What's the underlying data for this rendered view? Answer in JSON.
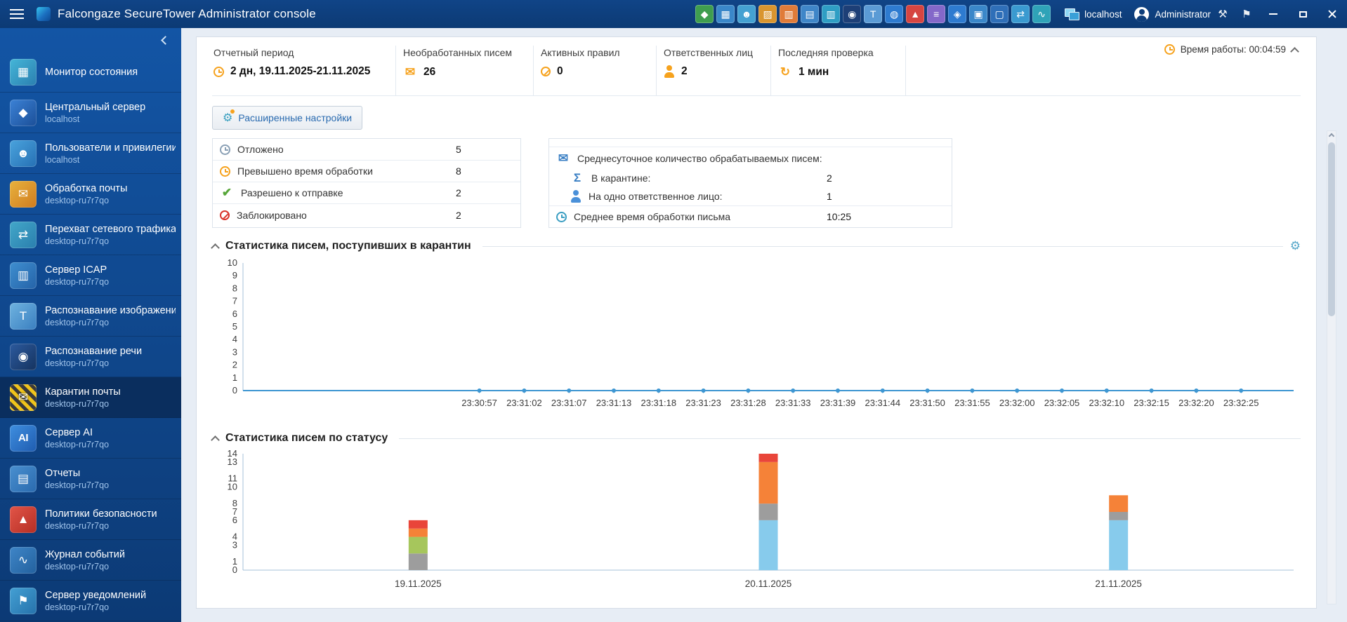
{
  "titlebar": {
    "title": "Falcongaze SecureTower Administrator console",
    "host": "localhost",
    "user": "Administrator",
    "toolbar_icons": [
      {
        "name": "shield",
        "glyph": "◆",
        "bg": "#3f9e4f"
      },
      {
        "name": "status-monitor",
        "glyph": "▦",
        "bg": "#3a87c9"
      },
      {
        "name": "users",
        "glyph": "☻",
        "bg": "#44a1d2"
      },
      {
        "name": "mail-archive",
        "glyph": "▨",
        "bg": "#d9952f"
      },
      {
        "name": "mail-processing",
        "glyph": "▥",
        "bg": "#e07b39"
      },
      {
        "name": "documents",
        "glyph": "▤",
        "bg": "#3f86c8"
      },
      {
        "name": "icap",
        "glyph": "▥",
        "bg": "#2f9ec4"
      },
      {
        "name": "speech-recognition",
        "glyph": "◉",
        "bg": "#1d3f77"
      },
      {
        "name": "image-recognition",
        "glyph": "T",
        "bg": "#5b9bd5"
      },
      {
        "name": "web",
        "glyph": "◍",
        "bg": "#2e7bd0"
      },
      {
        "name": "security-policies",
        "glyph": "▲",
        "bg": "#d64541"
      },
      {
        "name": "statistics",
        "glyph": "≡",
        "bg": "#8468c9"
      },
      {
        "name": "ai-server",
        "glyph": "◈",
        "bg": "#2e7bd0"
      },
      {
        "name": "endpoint",
        "glyph": "▣",
        "bg": "#3a87c9"
      },
      {
        "name": "console",
        "glyph": "▢",
        "bg": "#2f6fb8"
      },
      {
        "name": "network",
        "glyph": "⇄",
        "bg": "#3a9ad0"
      },
      {
        "name": "data-flow",
        "glyph": "∿",
        "bg": "#2fa3b8"
      }
    ]
  },
  "icon_glyphs": {
    "mail": "✉",
    "check": "✔",
    "sigma": "Σ",
    "refresh": "↻",
    "gear": "⚙",
    "tools": "⚒",
    "announcement": "⚑"
  },
  "sidebar": {
    "items": [
      {
        "id": "status-monitor",
        "label": "Монитор состояния",
        "sub": "",
        "glyph": "▦",
        "bg": "linear-gradient(135deg,#45b6d8,#2b7fb0)"
      },
      {
        "id": "central-server",
        "label": "Центральный сервер",
        "sub": "localhost",
        "glyph": "◆",
        "bg": "linear-gradient(135deg,#3c82d6,#1b4f98)"
      },
      {
        "id": "users-privileges",
        "label": "Пользователи и привилегии",
        "sub": "localhost",
        "glyph": "☻",
        "bg": "linear-gradient(135deg,#4aa3dd,#2670b4)"
      },
      {
        "id": "mail-processing",
        "label": "Обработка почты",
        "sub": "desktop-ru7r7qo",
        "glyph": "✉",
        "bg": "linear-gradient(135deg,#e8b23d,#d07c1f)"
      },
      {
        "id": "traffic-interception",
        "label": "Перехват сетевого трафика",
        "sub": "desktop-ru7r7qo",
        "glyph": "⇄",
        "bg": "linear-gradient(135deg,#43a7c9,#2a7fae)"
      },
      {
        "id": "icap-server",
        "label": "Сервер ICAP",
        "sub": "desktop-ru7r7qo",
        "glyph": "▥",
        "bg": "linear-gradient(135deg,#3f8fd0,#2563a8)"
      },
      {
        "id": "image-recognition",
        "label": "Распознавание изображений",
        "sub": "desktop-ru7r7qo",
        "glyph": "T",
        "bg": "linear-gradient(135deg,#6fb3e0,#3a7fc0)"
      },
      {
        "id": "speech-recognition",
        "label": "Распознавание речи",
        "sub": "desktop-ru7r7qo",
        "glyph": "◉",
        "bg": "linear-gradient(135deg,#2c5a9e,#15335f)"
      },
      {
        "id": "mail-quarantine",
        "label": "Карантин почты",
        "sub": "desktop-ru7r7qo",
        "glyph": "✉",
        "stripes": true,
        "selected": true
      },
      {
        "id": "ai-server",
        "label": "Сервер AI",
        "sub": "desktop-ru7r7qo",
        "glyph": "AI",
        "bg": "linear-gradient(135deg,#3f8fe0,#1f5cb0)"
      },
      {
        "id": "reports",
        "label": "Отчеты",
        "sub": "desktop-ru7r7qo",
        "glyph": "▤",
        "bg": "linear-gradient(135deg,#4a90d0,#2a6aae)"
      },
      {
        "id": "security-policies",
        "label": "Политики безопасности",
        "sub": "desktop-ru7r7qo",
        "glyph": "▲",
        "bg": "linear-gradient(135deg,#e25548,#b52e24)"
      },
      {
        "id": "event-log",
        "label": "Журнал событий",
        "sub": "desktop-ru7r7qo",
        "glyph": "∿",
        "bg": "linear-gradient(135deg,#3f86c8,#23619e)"
      },
      {
        "id": "notification-server",
        "label": "Сервер уведомлений",
        "sub": "desktop-ru7r7qo",
        "glyph": "⚑",
        "bg": "linear-gradient(135deg,#44a0d4,#2672ab)"
      }
    ]
  },
  "overview": {
    "uptime": "Время работы: 00:04:59",
    "advanced_button": "Расширенные настройки",
    "cards": [
      {
        "id": "report-period",
        "label": "Отчетный период",
        "value": "2 дн, 19.11.2025-21.11.2025",
        "icon": "clock",
        "icon_color": "#f6a21d"
      },
      {
        "id": "unprocessed-mail",
        "label": "Необработанных писем",
        "value": "26",
        "icon": "mail",
        "icon_color": "#f6a21d"
      },
      {
        "id": "active-rules",
        "label": "Активных правил",
        "value": "0",
        "icon": "ban",
        "icon_color": "#f6a21d"
      },
      {
        "id": "responsible-persons",
        "label": "Ответственных лиц",
        "value": "2",
        "icon": "person",
        "icon_color": "#f6a21d"
      },
      {
        "id": "last-check",
        "label": "Последняя проверка",
        "value": "1 мин",
        "icon": "refresh",
        "icon_color": "#f6a21d"
      }
    ]
  },
  "quarantine_stats": {
    "left_rows": [
      {
        "label": "Отложено",
        "value": "5",
        "icon": "clock",
        "icon_color": "#8aa0b5"
      },
      {
        "label": "Превышено время обработки",
        "value": "8",
        "icon": "clock",
        "icon_color": "#f6a21d"
      },
      {
        "label": "Разрешено к отправке",
        "value": "2",
        "icon": "check",
        "icon_color": "#57a639"
      },
      {
        "label": "Заблокировано",
        "value": "2",
        "icon": "ban",
        "icon_color": "#d9342b"
      }
    ],
    "right": {
      "header": {
        "label": "Среднесуточное количество обрабатываемых писем:",
        "icon": "mail",
        "icon_color": "#3a7fc4"
      },
      "rows": [
        {
          "label": "В карантине:",
          "value": "2",
          "icon": "sigma",
          "icon_color": "#3a7fc4"
        },
        {
          "label": "На одно ответственное лицо:",
          "value": "1",
          "icon": "person",
          "icon_color": "#4a90d9"
        }
      ],
      "footer": {
        "label": "Среднее время обработки письма",
        "value": "10:25",
        "icon": "clock",
        "icon_color": "#3a9ec2"
      }
    }
  },
  "chart_data": [
    {
      "type": "line",
      "title": "Статистика писем, поступивших в карантин",
      "x": [
        "23:30:57",
        "23:31:02",
        "23:31:07",
        "23:31:13",
        "23:31:18",
        "23:31:23",
        "23:31:28",
        "23:31:33",
        "23:31:39",
        "23:31:44",
        "23:31:50",
        "23:31:55",
        "23:32:00",
        "23:32:05",
        "23:32:10",
        "23:32:15",
        "23:32:20",
        "23:32:25"
      ],
      "values": [
        0,
        0,
        0,
        0,
        0,
        0,
        0,
        0,
        0,
        0,
        0,
        0,
        0,
        0,
        0,
        0,
        0,
        0
      ],
      "xlabel": "",
      "ylabel": "",
      "ylim": [
        0,
        10
      ],
      "yticks": [
        0,
        1,
        2,
        3,
        4,
        5,
        6,
        7,
        8,
        9,
        10
      ],
      "grid": false,
      "legend": "none",
      "line_color": "#3d96d2",
      "x_start_frac": 0.225,
      "x_end_frac": 0.95
    },
    {
      "type": "bar",
      "stacked": true,
      "title": "Статистика писем по статусу",
      "categories": [
        "19.11.2025",
        "20.11.2025",
        "21.11.2025"
      ],
      "series": [
        {
          "name": "quarantined-blue",
          "color": "#87cbec",
          "values": [
            0,
            6,
            6
          ]
        },
        {
          "name": "deferred-gray",
          "color": "#9d9d9d",
          "values": [
            2,
            2,
            1
          ]
        },
        {
          "name": "allowed-green",
          "color": "#a6c65c",
          "values": [
            2,
            0,
            0
          ]
        },
        {
          "name": "overtime-orange",
          "color": "#f58238",
          "values": [
            1,
            5,
            2
          ]
        },
        {
          "name": "blocked-red",
          "color": "#e9453a",
          "values": [
            1,
            1,
            0
          ]
        }
      ],
      "xlabel": "",
      "ylabel": "",
      "ylim": [
        0,
        14
      ],
      "yticks": [
        0,
        1,
        3,
        4,
        6,
        7,
        8,
        10,
        11,
        13,
        14
      ],
      "grid": false,
      "legend": "none"
    }
  ],
  "colors": {
    "accent_orange": "#f6a21d",
    "titlebar": "#0d3d7a",
    "sidebar_selected": "#0a2e5e",
    "axis": "#a5c0d8"
  }
}
